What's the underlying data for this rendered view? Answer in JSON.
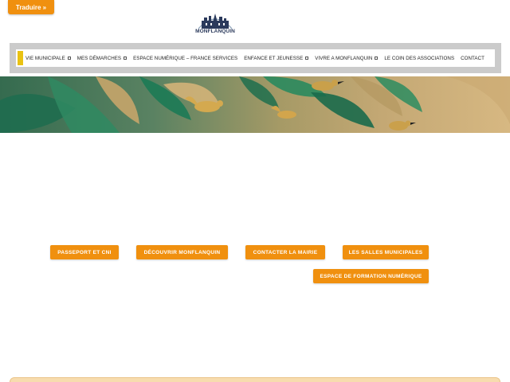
{
  "translate": {
    "label": "Traduire »"
  },
  "logo": {
    "text": "MONFLANQUIN"
  },
  "nav": {
    "items": [
      {
        "label": "VIE MUNICIPALE",
        "has_dropdown": true
      },
      {
        "label": "MES DÉMARCHES",
        "has_dropdown": true
      },
      {
        "label": "ESPACE NUMÉRIQUE – FRANCE SERVICES",
        "has_dropdown": false
      },
      {
        "label": "ENFANCE ET JEUNESSE",
        "has_dropdown": true
      },
      {
        "label": "VIVRE A MONFLANQUIN",
        "has_dropdown": true
      },
      {
        "label": "LE COIN DES ASSOCIATIONS",
        "has_dropdown": false
      },
      {
        "label": "CONTACT",
        "has_dropdown": false
      }
    ]
  },
  "buttons": {
    "passport": "PASSEPORT ET CNI",
    "discover": "DÉCOUVRIR MONFLANQUIN",
    "contact_mairie": "CONTACTER LA MAIRIE",
    "salles": "LES SALLES MUNICIPALES",
    "formation": "ESPACE DE FORMATION NUMÉRIQUE"
  },
  "colors": {
    "accent_orange": "#f0900f",
    "nav_accent_yellow": "#e9c212",
    "nav_frame_gray": "#cbcbcb"
  }
}
